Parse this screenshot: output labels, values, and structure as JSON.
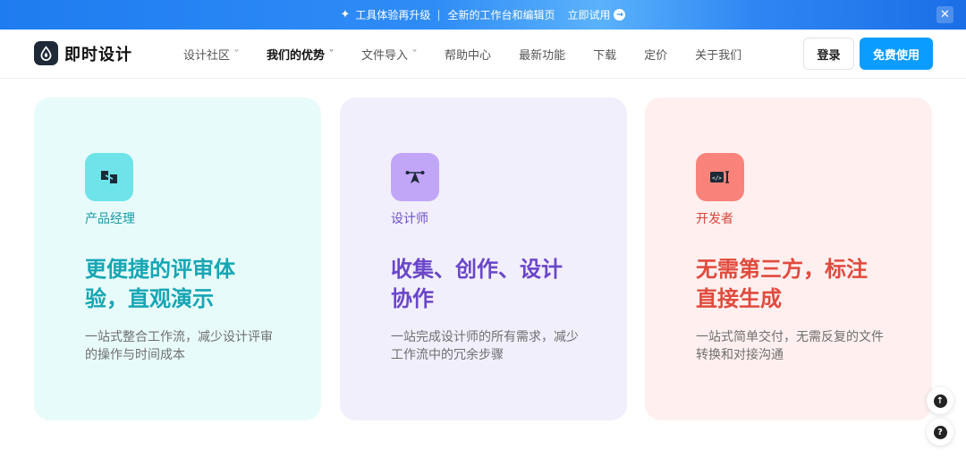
{
  "banner": {
    "text1": "工具体验再升级",
    "text2": "全新的工作台和编辑页",
    "cta": "立即试用",
    "bg_color": "#2f86f3"
  },
  "header": {
    "logo_text": "即时设计",
    "nav": [
      {
        "label": "设计社区",
        "has_dropdown": true
      },
      {
        "label": "我们的优势",
        "has_dropdown": true,
        "active": true
      },
      {
        "label": "文件导入",
        "has_dropdown": true
      },
      {
        "label": "帮助中心"
      },
      {
        "label": "最新功能"
      },
      {
        "label": "下载"
      },
      {
        "label": "定价"
      },
      {
        "label": "关于我们"
      }
    ],
    "login_label": "登录",
    "free_label": "免费使用",
    "accent_color": "#0a9cff"
  },
  "cards": [
    {
      "role": "产品经理",
      "headline": "更便捷的评审体验，直观演示",
      "desc": "一站式整合工作流，减少设计评审的操作与时间成本",
      "icon": "presentation-icon",
      "theme_color": "#17a6b4"
    },
    {
      "role": "设计师",
      "headline": "收集、创作、设计协作",
      "desc": "一站完成设计师的所有需求，减少工作流中的冗余步骤",
      "icon": "pen-tool-icon",
      "theme_color": "#6a46c9"
    },
    {
      "role": "开发者",
      "headline": "无需第三方，标注直接生成",
      "desc": "一站式简单交付，无需反复的文件转换和对接沟通",
      "icon": "code-icon",
      "theme_color": "#e04b3e"
    }
  ],
  "floating": {
    "top_icon": "arrow-up-icon",
    "help_icon": "question-icon"
  }
}
